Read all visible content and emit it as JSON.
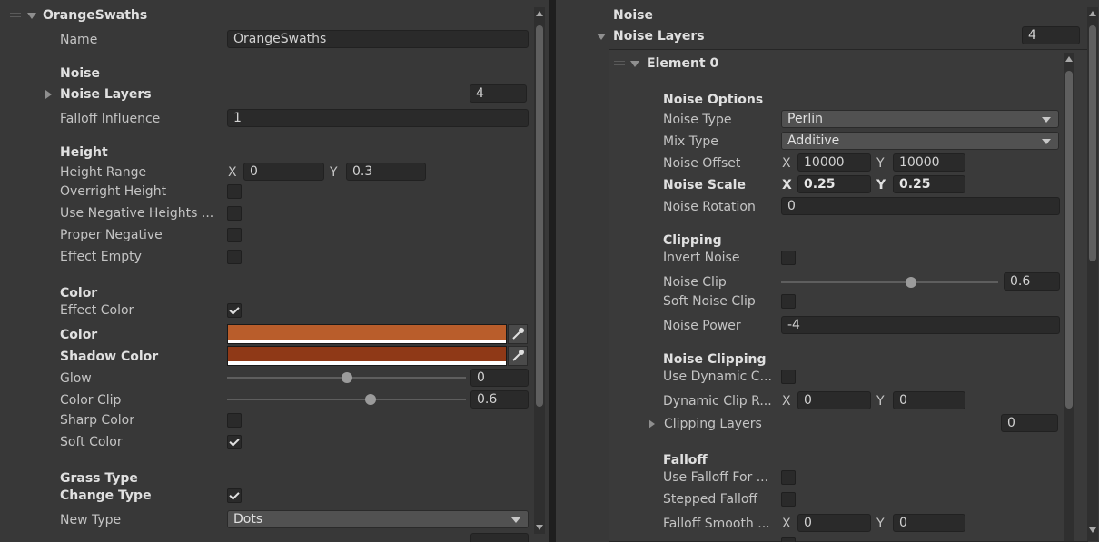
{
  "left": {
    "header": "OrangeSwaths",
    "name_label": "Name",
    "name_value": "OrangeSwaths",
    "noise_header": "Noise",
    "noise_layers_label": "Noise Layers",
    "noise_layers_count": "4",
    "falloff_influence_label": "Falloff Influence",
    "falloff_influence_value": "1",
    "height_header": "Height",
    "height_range_label": "Height Range",
    "x_label": "X",
    "y_label": "Y",
    "height_range_x": "0",
    "height_range_y": "0.3",
    "overright_height_label": "Overright Height",
    "use_negative_heights_label": "Use Negative Heights ...",
    "proper_negative_label": "Proper Negative",
    "effect_empty_label": "Effect Empty",
    "color_header": "Color",
    "effect_color_label": "Effect Color",
    "color_label": "Color",
    "color_hex": "#b95d2b",
    "shadow_color_label": "Shadow Color",
    "shadow_color_hex": "#8f3917",
    "glow_label": "Glow",
    "glow_value": "0",
    "glow_fraction": 0.5,
    "color_clip_label": "Color Clip",
    "color_clip_value": "0.6",
    "color_clip_fraction": 0.6,
    "sharp_color_label": "Sharp Color",
    "soft_color_label": "Soft Color",
    "grass_type_header": "Grass Type",
    "change_type_label": "Change Type",
    "new_type_label": "New Type",
    "new_type_value": "Dots"
  },
  "right": {
    "noise_header": "Noise",
    "noise_layers_label": "Noise Layers",
    "noise_layers_count": "4",
    "element_label": "Element 0",
    "noise_options_header": "Noise Options",
    "noise_type_label": "Noise Type",
    "noise_type_value": "Perlin",
    "mix_type_label": "Mix Type",
    "mix_type_value": "Additive",
    "noise_offset_label": "Noise Offset",
    "x_label": "X",
    "y_label": "Y",
    "noise_offset_x": "10000",
    "noise_offset_y": "10000",
    "noise_scale_label": "Noise Scale",
    "noise_scale_x": "0.25",
    "noise_scale_y": "0.25",
    "noise_rotation_label": "Noise Rotation",
    "noise_rotation_value": "0",
    "clipping_header": "Clipping",
    "invert_noise_label": "Invert Noise",
    "noise_clip_label": "Noise Clip",
    "noise_clip_value": "0.6",
    "noise_clip_fraction": 0.6,
    "soft_noise_clip_label": "Soft Noise Clip",
    "noise_power_label": "Noise Power",
    "noise_power_value": "-4",
    "noise_clipping_header": "Noise Clipping",
    "use_dynamic_label": "Use Dynamic C...",
    "dynamic_clip_label": "Dynamic Clip R...",
    "dynamic_clip_x": "0",
    "dynamic_clip_y": "0",
    "clipping_layers_label": "Clipping Layers",
    "clipping_layers_count": "0",
    "falloff_header": "Falloff",
    "use_falloff_label": "Use Falloff For ...",
    "stepped_falloff_label": "Stepped Falloff",
    "falloff_smooth_label": "Falloff Smooth ...",
    "falloff_smooth_x": "0",
    "falloff_smooth_y": "0"
  }
}
